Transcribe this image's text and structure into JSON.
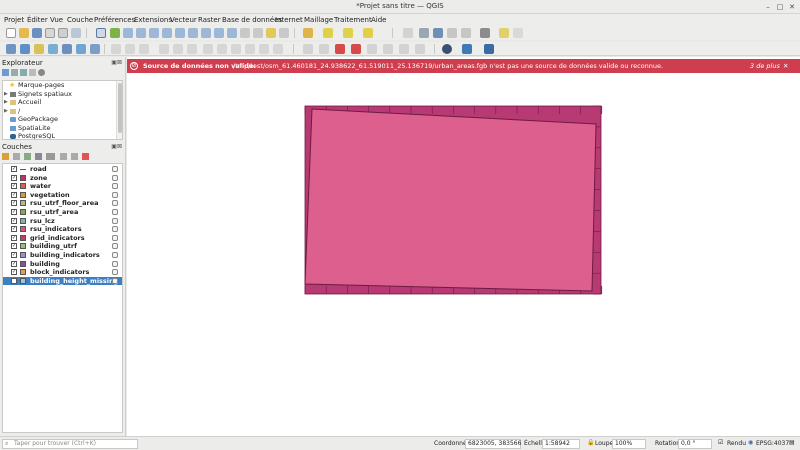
{
  "window": {
    "title": "*Projet sans titre — QGIS"
  },
  "menu": [
    "Projet",
    "Éditer",
    "Vue",
    "Couche",
    "Préférences",
    "Extensions",
    "Vecteur",
    "Raster",
    "Base de données",
    "Internet",
    "Maillage",
    "Traitement",
    "Aide"
  ],
  "browser": {
    "title": "Explorateur",
    "items": [
      {
        "label": "Marque-pages",
        "icon": "star-icon",
        "color": "#f2c318"
      },
      {
        "label": "Signets spatiaux",
        "icon": "bookmark-icon",
        "color": "#7a7a7a"
      },
      {
        "label": "Accueil",
        "icon": "folder-icon",
        "color": "#d9c67a"
      },
      {
        "label": "/",
        "icon": "folder-icon",
        "color": "#d9c67a"
      },
      {
        "label": "GeoPackage",
        "icon": "geopackage-icon",
        "color": "#6a9bd1"
      },
      {
        "label": "SpatiaLite",
        "icon": "spatialite-icon",
        "color": "#6a9bd1"
      },
      {
        "label": "PostgreSQL",
        "icon": "postgresql-icon",
        "color": "#33618c"
      }
    ]
  },
  "layers_panel": {
    "title": "Couches",
    "layers": [
      {
        "name": "road",
        "color": "#555555",
        "line": true,
        "checked": true,
        "selected": false
      },
      {
        "name": "zone",
        "color": "#c0336a",
        "checked": true,
        "selected": false
      },
      {
        "name": "water",
        "color": "#d9644d",
        "checked": true,
        "selected": false
      },
      {
        "name": "vegetation",
        "color": "#d69a3b",
        "checked": true,
        "selected": false
      },
      {
        "name": "rsu_utrf_floor_area",
        "color": "#b8b49a",
        "checked": true,
        "selected": false
      },
      {
        "name": "rsu_utrf_area",
        "color": "#7faa5a",
        "checked": true,
        "selected": false
      },
      {
        "name": "rsu_lcz",
        "color": "#84b3a6",
        "checked": true,
        "selected": false
      },
      {
        "name": "rsu_indicators",
        "color": "#d8557f",
        "checked": true,
        "selected": false
      },
      {
        "name": "grid_indicators",
        "color": "#c23d6f",
        "checked": true,
        "selected": false
      },
      {
        "name": "building_utrf",
        "color": "#8fc273",
        "checked": true,
        "selected": false
      },
      {
        "name": "building_indicators",
        "color": "#9a92cf",
        "checked": true,
        "selected": false
      },
      {
        "name": "building",
        "color": "#8a4ca3",
        "checked": true,
        "selected": false
      },
      {
        "name": "block_indicators",
        "color": "#e69a5a",
        "checked": true,
        "selected": false
      },
      {
        "name": "building_height_missing",
        "color": "#9ec6e8",
        "checked": false,
        "selected": true
      }
    ]
  },
  "message": {
    "prefix": "Source de données non valide:",
    "text": " /tmp/test/osm_61.460181_24.938622_61.519011_25.136719/urban_areas.fgb n'est pas une source de données valide ou reconnue.",
    "more": "3 de plus"
  },
  "map": {
    "fill_color": "#dc5f8e",
    "outline_color": "#6e1b43",
    "grid_color": "#b83a72"
  },
  "status": {
    "search_placeholder": "Taper pour trouver (Ctrl+K)",
    "coordinate_label": "Coordonnée",
    "coordinate_value": "6823005, 383566",
    "scale_label": "Échelle",
    "scale_value": "1:58942",
    "magnifier_label": "Loupe",
    "magnifier_value": "100%",
    "rotation_label": "Rotation",
    "rotation_value": "0,0 °",
    "render_label": "Rendu",
    "crs_label": "EPSG:4037"
  }
}
